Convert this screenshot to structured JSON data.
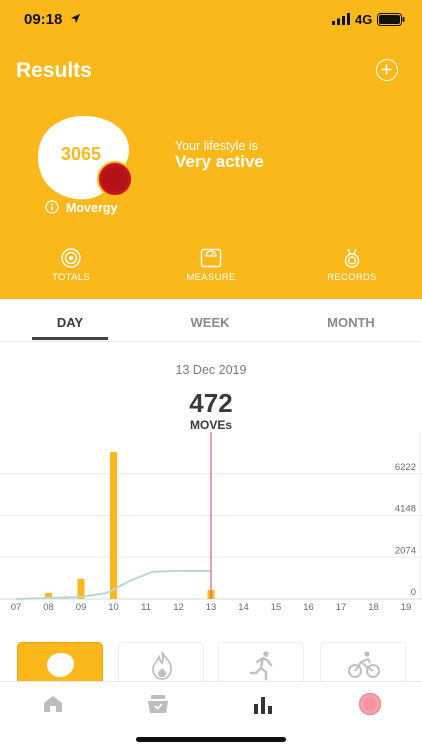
{
  "status_bar": {
    "time": "09:18",
    "network": "4G"
  },
  "header": {
    "title": "Results",
    "score": "3065",
    "score_label": "Movergy",
    "lifestyle_label": "Your lifestyle is",
    "lifestyle_value": "Very active"
  },
  "quick_nav": [
    {
      "label": "TOTALS",
      "icon": "totals-icon"
    },
    {
      "label": "MEASURE",
      "icon": "scale-icon"
    },
    {
      "label": "RECORDS",
      "icon": "medal-icon"
    }
  ],
  "tabs": [
    {
      "label": "DAY",
      "active": true
    },
    {
      "label": "WEEK",
      "active": false
    },
    {
      "label": "MONTH",
      "active": false
    }
  ],
  "summary": {
    "date": "13 Dec 2019",
    "total": "472",
    "unit": "MOVEs"
  },
  "chart_data": {
    "type": "bar",
    "categories": [
      "07",
      "08",
      "09",
      "10",
      "11",
      "12",
      "13",
      "14",
      "15",
      "16",
      "17",
      "18",
      "19"
    ],
    "x_range": [
      7,
      19.4
    ],
    "ylim": [
      0,
      8296
    ],
    "y_ticks": [
      "0",
      "2074",
      "4148",
      "6222"
    ],
    "bars": [
      {
        "x": 8.0,
        "value": 300
      },
      {
        "x": 9.0,
        "value": 1000
      },
      {
        "x": 10.0,
        "value": 7300
      },
      {
        "x": 13.0,
        "value": 450
      }
    ],
    "line": [
      {
        "x": 7.0,
        "y": 0
      },
      {
        "x": 9.0,
        "y": 100
      },
      {
        "x": 9.8,
        "y": 300
      },
      {
        "x": 10.5,
        "y": 900
      },
      {
        "x": 11.2,
        "y": 1350
      },
      {
        "x": 12.0,
        "y": 1400
      },
      {
        "x": 13.0,
        "y": 1400
      }
    ],
    "marker_x": 13.0,
    "grid": true,
    "colors": {
      "bar": "#fbb81a",
      "line": "#bcd5d3",
      "marker": "#e0607a",
      "grid": "#ececec"
    }
  },
  "categories": [
    {
      "icon": "movergy-blob-icon",
      "active": true
    },
    {
      "icon": "flame-icon",
      "active": false
    },
    {
      "icon": "running-icon",
      "active": false
    },
    {
      "icon": "cycling-icon",
      "active": false
    }
  ],
  "bottom_nav": [
    {
      "icon": "home-icon"
    },
    {
      "icon": "inbox-icon"
    },
    {
      "icon": "bar-chart-icon"
    },
    {
      "icon": "profile-icon"
    }
  ],
  "colors": {
    "brand": "#fbb81a",
    "accent_red": "#c8141e"
  }
}
